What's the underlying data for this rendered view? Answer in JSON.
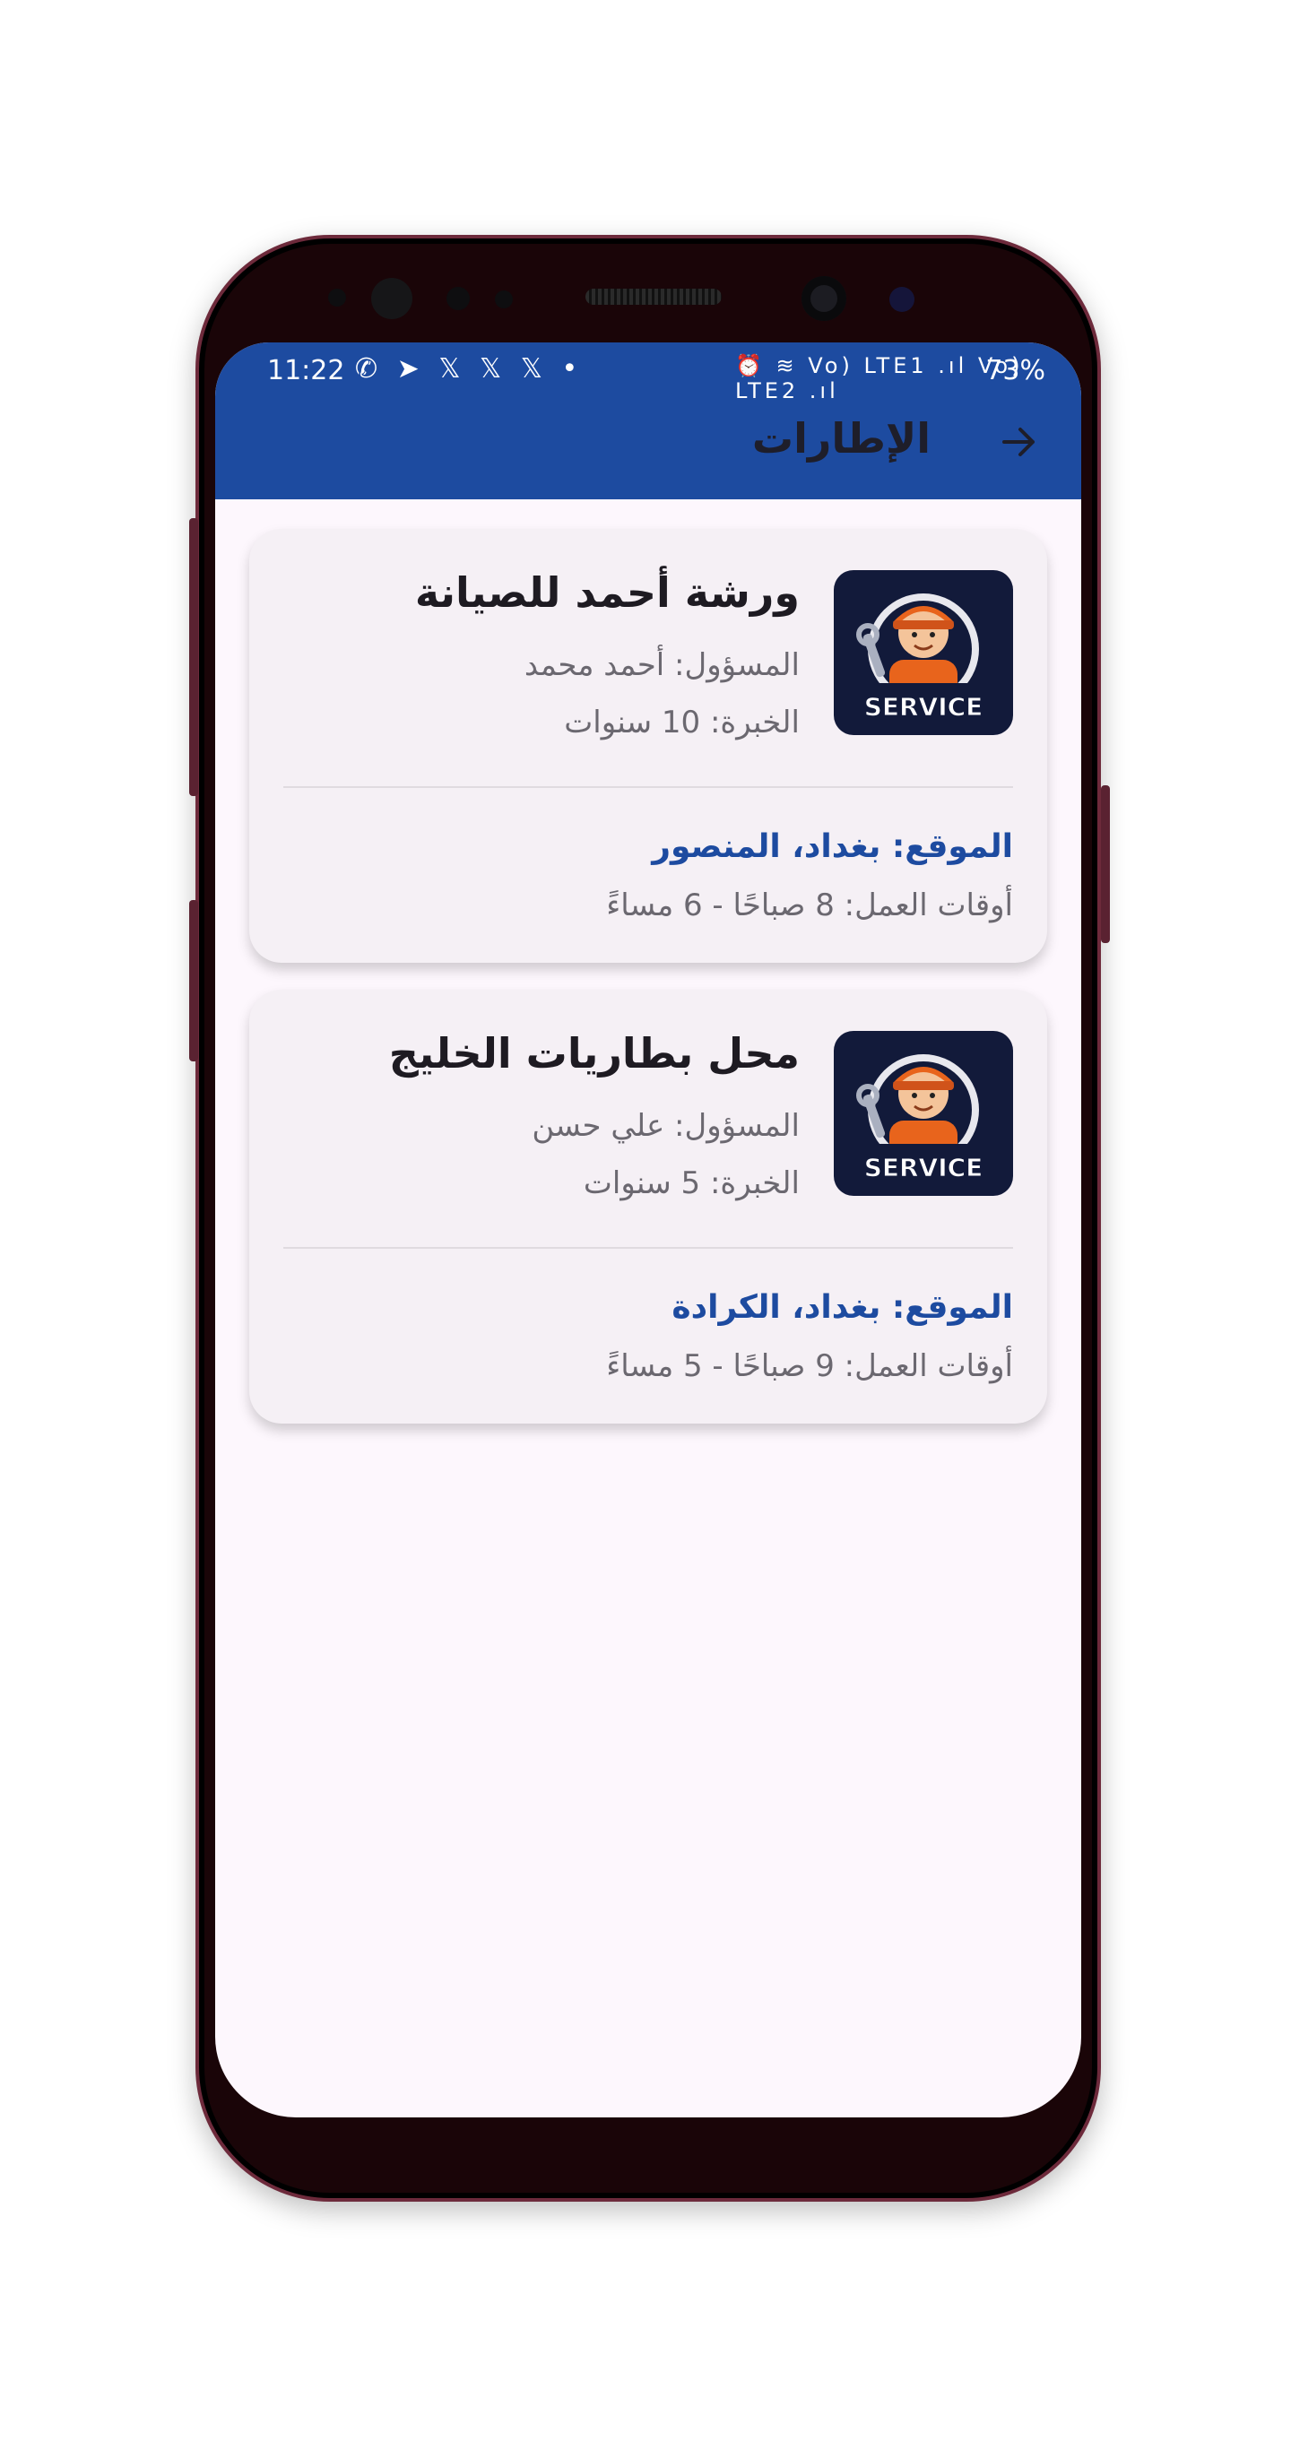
{
  "status_bar": {
    "time": "11:22",
    "left_icons": "✆ ➤ 𝕏 𝕏 𝕏 •",
    "right_icons": "⏰ ≋ Vo) LTE1 .ıl Vo) LTE2 .ıl",
    "battery": "73%"
  },
  "appbar": {
    "title": "الإطارات",
    "back_icon": "arrow-right-icon"
  },
  "colors": {
    "appbar": "#1d4ba0",
    "location_text": "#1d4ba0",
    "background": "#fdf7fd",
    "card": "#f5f0f5"
  },
  "shops": [
    {
      "name": "ورشة أحمد للصيانة",
      "owner": "المسؤول: أحمد محمد",
      "experience": "الخبرة: 10 سنوات",
      "location": "الموقع: بغداد، المنصور",
      "hours": "أوقات العمل: 8 صباحًا - 6 مساءً",
      "logo_text": "SERVICE"
    },
    {
      "name": "محل بطاريات الخليج",
      "owner": "المسؤول: علي حسن",
      "experience": "الخبرة: 5 سنوات",
      "location": "الموقع: بغداد، الكرادة",
      "hours": "أوقات العمل: 9 صباحًا - 5 مساءً",
      "logo_text": "SERVICE"
    }
  ]
}
